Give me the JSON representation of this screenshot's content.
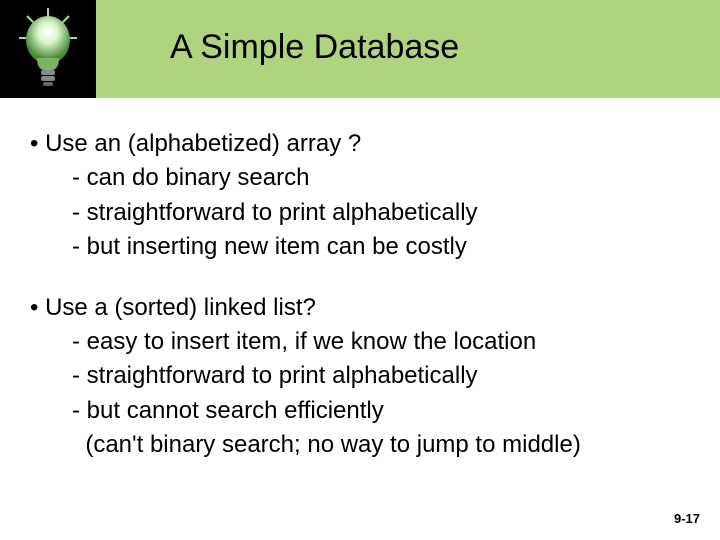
{
  "header": {
    "title": "A Simple Database",
    "icon": "lightbulb-icon"
  },
  "bullets": [
    {
      "lead": "• Use an (alphabetized) array ?",
      "subs": [
        "- can do binary search",
        "- straightforward to print alphabetically",
        "- but inserting new item can be costly"
      ]
    },
    {
      "lead": "• Use a (sorted) linked list?",
      "subs": [
        "- easy to insert item, if we know the location",
        "- straightforward to print alphabetically",
        "- but cannot search efficiently",
        "  (can't binary search; no way to jump to middle)"
      ]
    }
  ],
  "footer": {
    "page_label": "9-17"
  }
}
